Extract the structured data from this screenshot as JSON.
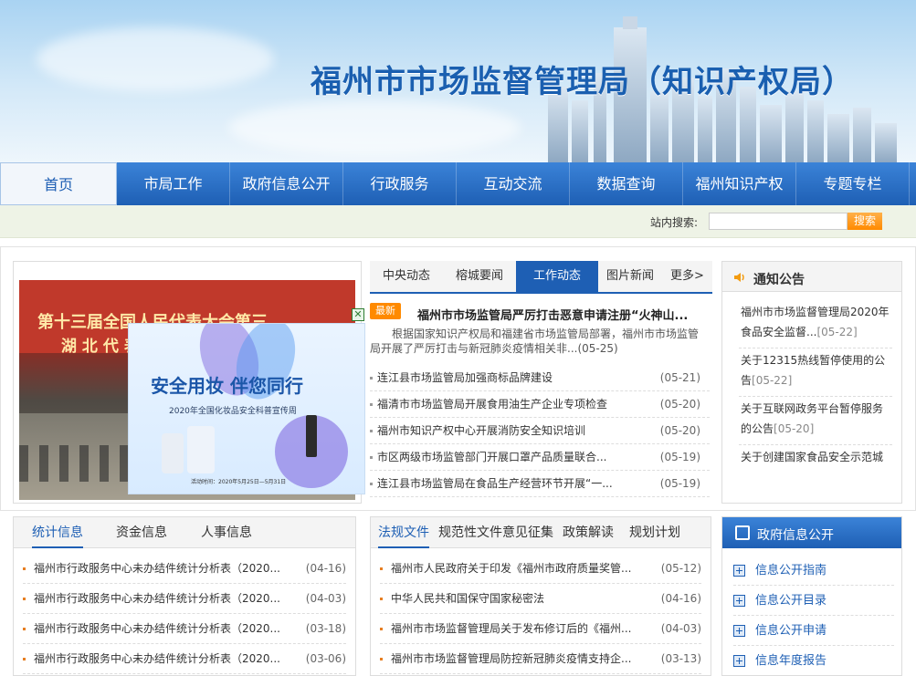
{
  "site": {
    "title": "福州市市场监督管理局（知识产权局）"
  },
  "nav": [
    "首页",
    "市局工作",
    "政府信息公开",
    "行政服务",
    "互动交流",
    "数据查询",
    "福州知识产权",
    "专题专栏"
  ],
  "search": {
    "label": "站内搜索:",
    "button": "搜索",
    "value": ""
  },
  "carousel": {
    "photo_caption_line1": "第十三届全国人民代表大会第三",
    "photo_caption_line2": "湖 北 代 表 团 全 体 会 议",
    "ad": {
      "title": "安全用妆 伴您同行",
      "subtitle": "2020年全国化妆品安全科普宣传周",
      "date": "活动时间：2020年5月25日—5月31日"
    },
    "close_icon": "✕"
  },
  "news": {
    "tabs": [
      "中央动态",
      "榕城要闻",
      "工作动态",
      "图片新闻",
      "更多>"
    ],
    "active_tab": 2,
    "badge": "最新",
    "headline": "福州市市场监管局严厉打击恶意申请注册“火神山...",
    "summary": "根据国家知识产权局和福建省市场监管局部署，福州市市场监管局开展了严厉打击与新冠肺炎疫情相关非...(05-25)",
    "items": [
      {
        "text": "连江县市场监管局加强商标品牌建设",
        "date": "(05-21)"
      },
      {
        "text": "福清市市场监管局开展食用油生产企业专项检查",
        "date": "(05-20)"
      },
      {
        "text": "福州市知识产权中心开展消防安全知识培训",
        "date": "(05-20)"
      },
      {
        "text": "市区两级市场监管部门开展口罩产品质量联合...",
        "date": "(05-19)"
      },
      {
        "text": "连江县市场监管局在食品生产经营环节开展“一...",
        "date": "(05-19)"
      }
    ]
  },
  "notice": {
    "title": "通知公告",
    "items": [
      {
        "text": "福州市市场监督管理局2020年食品安全监督...",
        "date": "[05-22]"
      },
      {
        "text": "关于12315热线暂停使用的公告",
        "date": "[05-22]"
      },
      {
        "text": "关于互联网政务平台暂停服务的公告",
        "date": "[05-20]"
      },
      {
        "text": "关于创建国家食品安全示范城",
        "date": ""
      }
    ]
  },
  "stats": {
    "tabs": [
      "统计信息",
      "资金信息",
      "人事信息"
    ],
    "items": [
      {
        "text": "福州市行政服务中心未办结件统计分析表（2020...",
        "date": "(04-16)"
      },
      {
        "text": "福州市行政服务中心未办结件统计分析表（2020...",
        "date": "(04-03)"
      },
      {
        "text": "福州市行政服务中心未办结件统计分析表（2020...",
        "date": "(03-18)"
      },
      {
        "text": "福州市行政服务中心未办结件统计分析表（2020...",
        "date": "(03-06)"
      }
    ]
  },
  "laws": {
    "tabs": [
      "法规文件",
      "规范性文件意见征集",
      "政策解读",
      "规划计划"
    ],
    "items": [
      {
        "text": "福州市人民政府关于印发《福州市政府质量奖管...",
        "date": "(05-12)"
      },
      {
        "text": "中华人民共和国保守国家秘密法",
        "date": "(04-16)"
      },
      {
        "text": "福州市市场监督管理局关于发布修订后的《福州...",
        "date": "(04-03)"
      },
      {
        "text": "福州市市场监督管理局防控新冠肺炎疫情支持企...",
        "date": "(03-13)"
      }
    ]
  },
  "gov": {
    "title": "政府信息公开",
    "items": [
      "信息公开指南",
      "信息公开目录",
      "信息公开申请",
      "信息年度报告"
    ]
  },
  "colors": {
    "primary": "#1e5fb4",
    "accent": "#ff8a00"
  }
}
